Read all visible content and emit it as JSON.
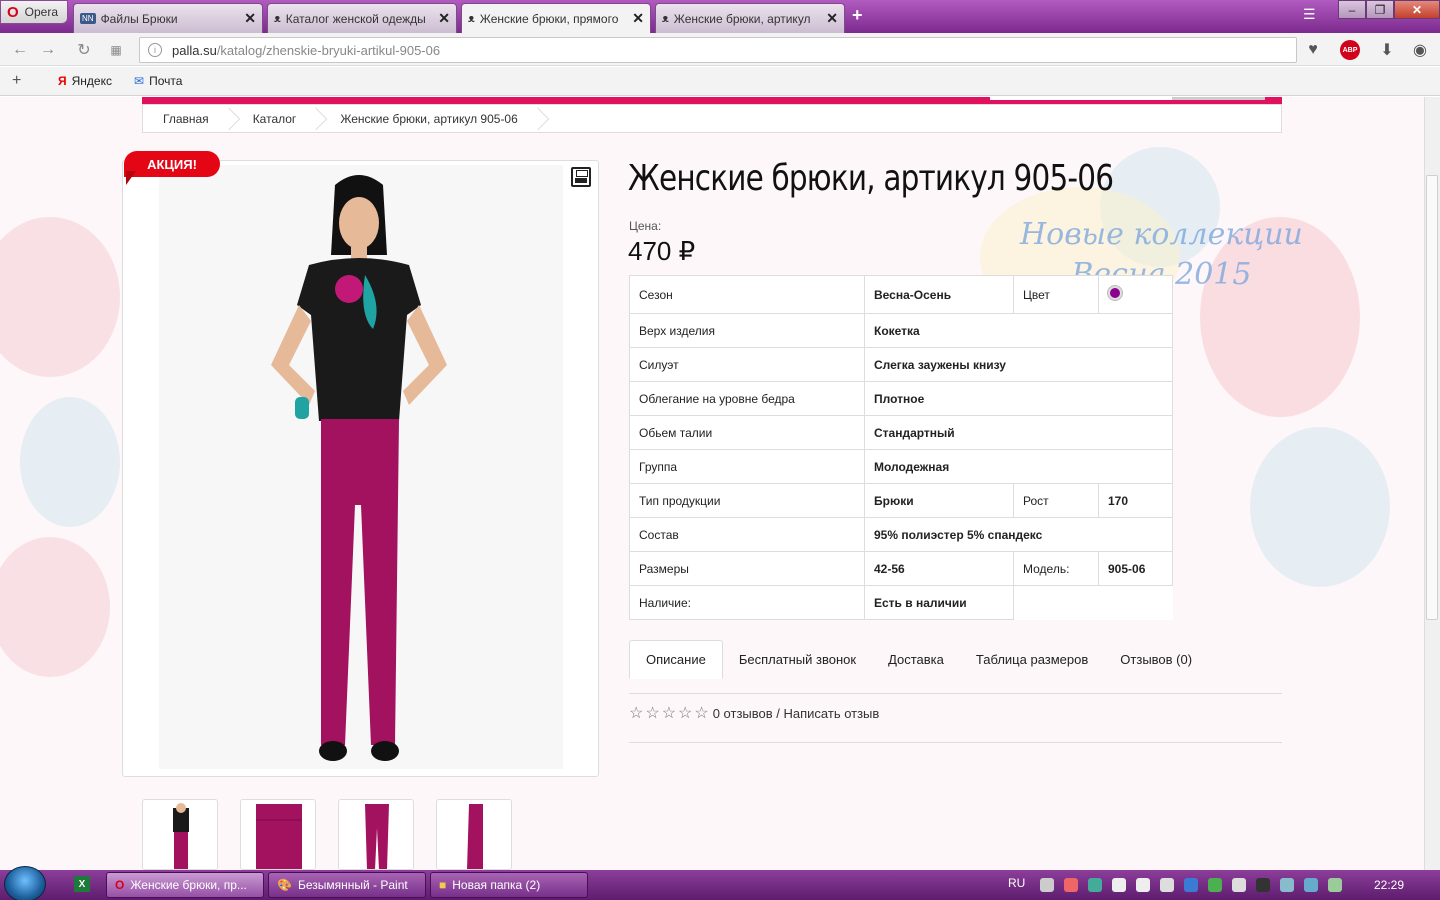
{
  "browser": {
    "menu_label": "Opera",
    "tabs": [
      {
        "label": "Файлы Брюки",
        "active": false
      },
      {
        "label": "Каталог женской одежды",
        "active": false
      },
      {
        "label": "Женские брюки, прямого",
        "active": true
      },
      {
        "label": "Женские брюки, артикул",
        "active": false
      }
    ],
    "new_tab": "+",
    "url_domain": "palla.su",
    "url_path": "/katalog/zhenskie-bryuki-artikul-905-06",
    "bookmarks": [
      "Яндекс",
      "Почта"
    ],
    "abp_badge": "ABP"
  },
  "breadcrumb": [
    "Главная",
    "Каталог",
    "Женские брюки, артикул 905-06"
  ],
  "product": {
    "sale_badge": "АКЦИЯ!",
    "title": "Женские брюки, артикул 905-06",
    "price_label": "Цена:",
    "price": "470 ₽",
    "promo_line1": "Новые коллекции",
    "promo_line2": "Весна 2015",
    "specs": {
      "season_label": "Сезон",
      "season": "Весна-Осень",
      "color_label": "Цвет",
      "color": "#8b0090",
      "top_label": "Верх изделия",
      "top": "Кокетка",
      "silhouette_label": "Силуэт",
      "silhouette": "Слегка заужены книзу",
      "fit_label": "Облегание на уровне бедра",
      "fit": "Плотное",
      "waist_label": "Обьем талии",
      "waist": "Стандартный",
      "group_label": "Группа",
      "group": "Молодежная",
      "type_label": "Тип продукции",
      "type": "Брюки",
      "height_label": "Рост",
      "height": "170",
      "composition_label": "Состав",
      "composition": "95% полиэстер 5% спандекс",
      "sizes_label": "Размеры",
      "sizes": "42-56",
      "model_label": "Модель:",
      "model": "905-06",
      "availability_label": "Наличие:",
      "availability": "Есть в наличии"
    },
    "tabs": [
      "Описание",
      "Бесплатный звонок",
      "Доставка",
      "Таблица размеров",
      "Отзывов (0)"
    ],
    "reviews_text": "0 отзывов / Написать отзыв",
    "rating": 0
  },
  "taskbar": {
    "tasks": [
      "Женские брюки, пр...",
      "Безымянный - Paint",
      "Новая папка (2)"
    ],
    "lang": "RU",
    "time": "22:29"
  },
  "colors": {
    "accent": "#e0115f",
    "sale": "#e40515",
    "pants": "#a3125f",
    "taskbar": "#7c2a8e"
  }
}
